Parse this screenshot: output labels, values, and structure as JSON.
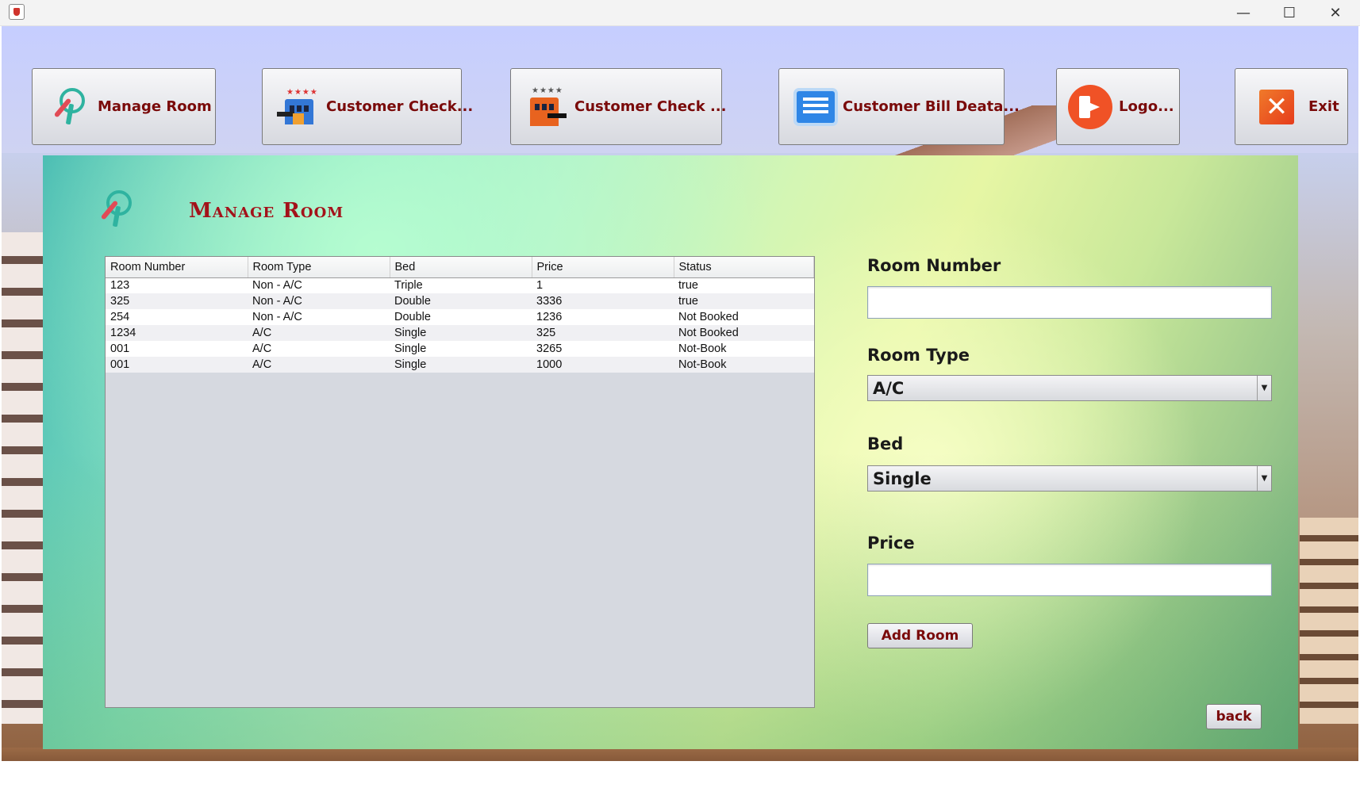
{
  "window": {
    "minimize_glyph": "—",
    "maximize_glyph": "☐",
    "close_glyph": "✕"
  },
  "nav": {
    "manage_room": "Manage Room",
    "customer_checkin": "Customer Check...",
    "customer_checkout": "Customer Check ...",
    "customer_bill": "Customer Bill Deata...",
    "logout": "Logo...",
    "exit": "Exit"
  },
  "page": {
    "title": "Manage Room"
  },
  "table": {
    "columns": [
      "Room Number",
      "Room Type",
      "Bed",
      "Price",
      "Status"
    ],
    "rows": [
      [
        "123",
        "Non - A/C",
        "Triple",
        "1",
        "true"
      ],
      [
        "325",
        "Non - A/C",
        "Double",
        "3336",
        "true"
      ],
      [
        "254",
        "Non - A/C",
        "Double",
        "1236",
        "Not Booked"
      ],
      [
        "1234",
        "A/C",
        "Single",
        "325",
        "Not Booked"
      ],
      [
        "001",
        "A/C",
        "Single",
        "3265",
        "Not-Book"
      ],
      [
        "001",
        "A/C",
        "Single",
        "1000",
        "Not-Book"
      ]
    ]
  },
  "form": {
    "room_number_label": "Room Number",
    "room_number_value": "",
    "room_type_label": "Room Type",
    "room_type_value": "A/C",
    "bed_label": "Bed",
    "bed_value": "Single",
    "price_label": "Price",
    "price_value": "",
    "add_button": "Add Room",
    "back_button": "back"
  },
  "icons": {
    "manage_room": "key-icon",
    "checkin": "hotel-checkin-icon",
    "checkout": "hotel-checkout-icon",
    "bill": "bill-list-icon",
    "logout": "logout-icon",
    "exit": "exit-x-icon",
    "dropdown": "chevron-down-icon"
  },
  "colors": {
    "accent_text": "#7a0a0a",
    "title_red": "#a3121a"
  }
}
